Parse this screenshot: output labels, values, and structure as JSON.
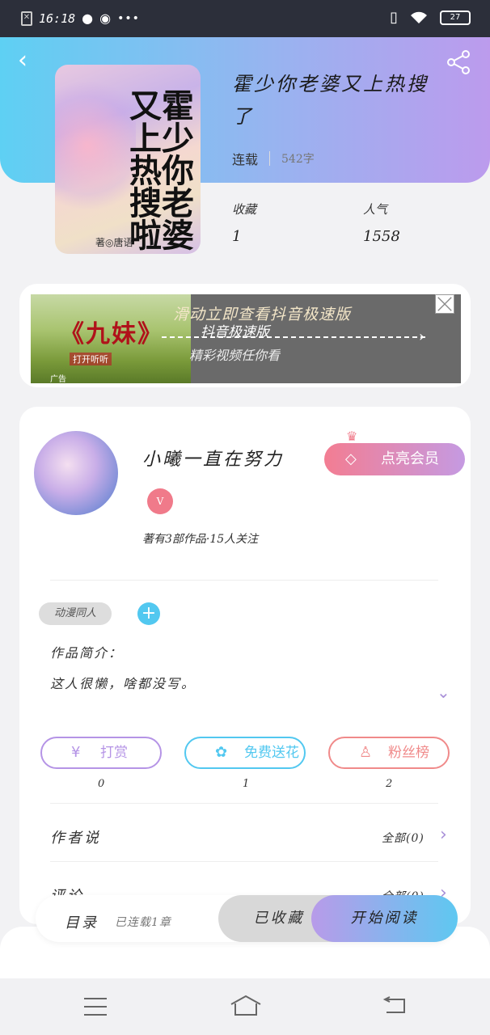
{
  "status_bar": {
    "time": "16:18",
    "notification_icons": [
      "sim-error-icon",
      "qq-icon",
      "wechat-icon",
      "more-dots-icon"
    ],
    "system_icons": [
      "vibrate-icon",
      "wifi-icon",
      "battery-icon"
    ],
    "battery_level": "27"
  },
  "header": {
    "back_icon": "chevron-left-icon",
    "share_icon": "share-icon",
    "gradient": [
      "#5ed0f3",
      "#bc9bed"
    ]
  },
  "book": {
    "cover_title": "霍少你老婆又上热搜啦",
    "cover_author": "著◎唐语",
    "title": "霍少你老婆又上热搜了",
    "status": "连载",
    "word_count": "542字",
    "favorites_label": "收藏",
    "favorites_value": "1",
    "popularity_label": "人气",
    "popularity_value": "1558"
  },
  "ad": {
    "banner_title": "《九妹》",
    "banner_sub": "打开听听",
    "banner_tag": "广告",
    "line1": "滑动立即查看抖音极速版",
    "line2": "抖音极速版",
    "line3": "精彩视频任你看",
    "close_icon": "close-icon"
  },
  "author": {
    "name": "小曦一直在努力",
    "badge": "V",
    "stats": "著有3部作品·15人关注",
    "vip_button": "点亮会员",
    "vip_icon": "diamond-icon",
    "crown_icon": "crown-icon"
  },
  "tags": {
    "chip": "动漫同人",
    "add_icon": "plus-icon"
  },
  "intro": {
    "label": "作品简介：",
    "text": "这人很懒，啥都没写。",
    "expand_icon": "chevron-down-icon"
  },
  "actions": [
    {
      "label": "打赏",
      "icon": "yen-coin-icon",
      "count": "0",
      "color": "#b594e6"
    },
    {
      "label": "免费送花",
      "icon": "flower-icon",
      "count": "1",
      "color": "#52c8f0"
    },
    {
      "label": "粉丝榜",
      "icon": "fan-user-icon",
      "count": "2",
      "color": "#f08a8a"
    }
  ],
  "sections": [
    {
      "label": "作者说",
      "right": "全部(0)"
    },
    {
      "label": "评论",
      "right": "全部(0)"
    }
  ],
  "bottom_bar": {
    "toc_label": "目录",
    "toc_status": "已连载1章",
    "saved_label": "已收藏",
    "read_label": "开始阅读"
  },
  "nav": {
    "menu_icon": "menu-icon",
    "home_icon": "home-icon",
    "back_icon": "back-icon"
  }
}
